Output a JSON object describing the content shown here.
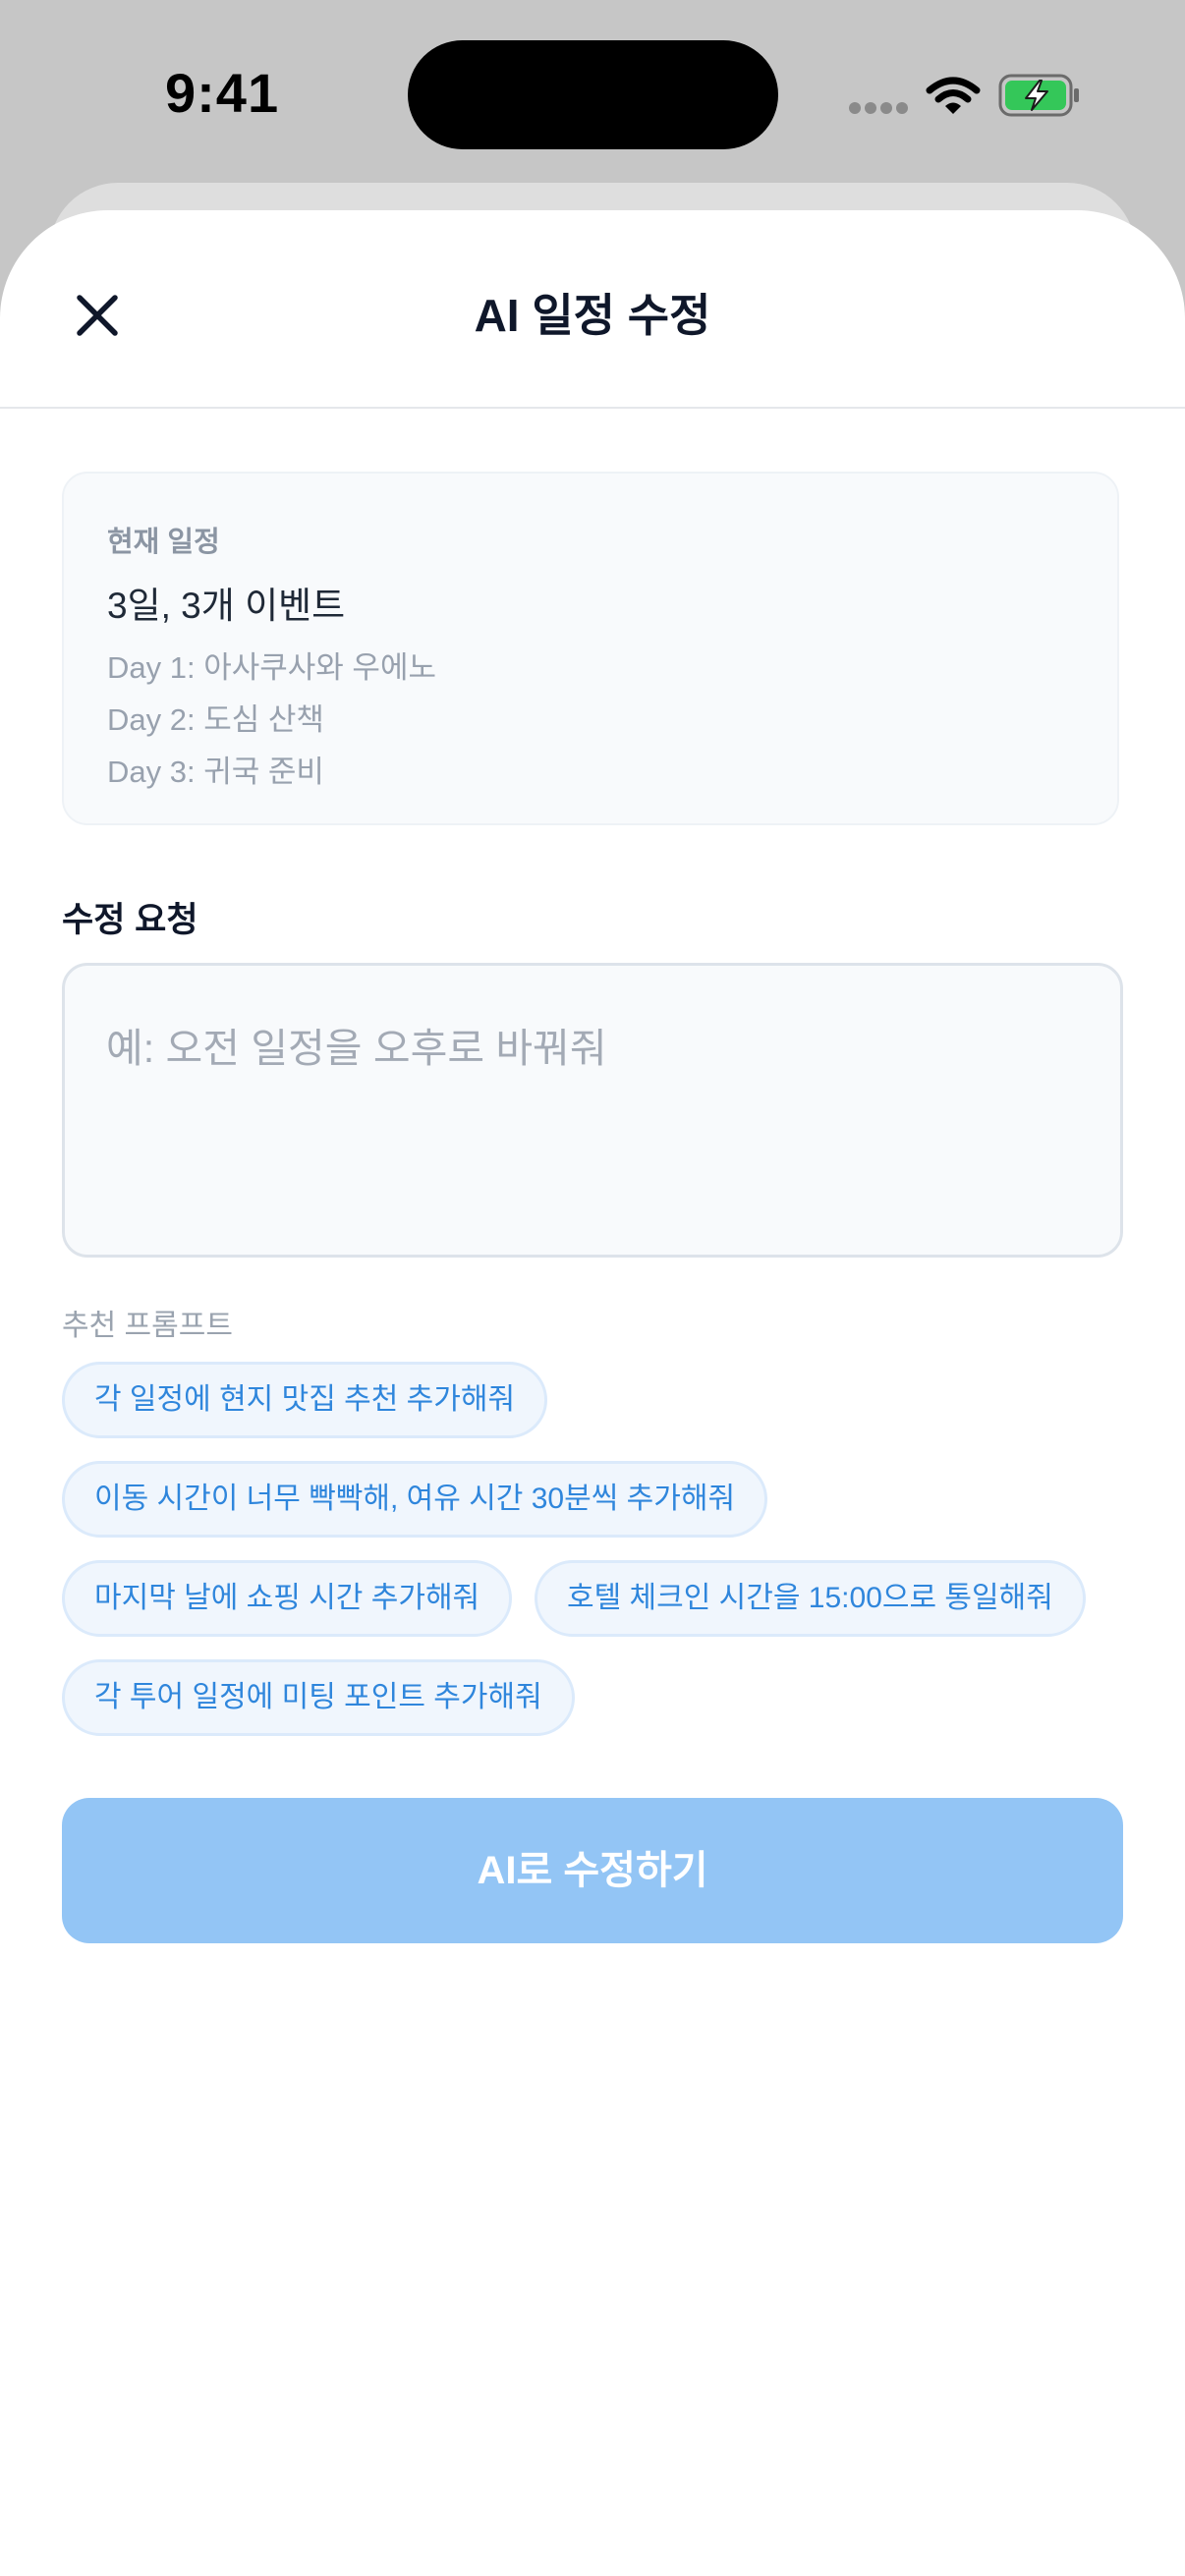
{
  "status_bar": {
    "time": "9:41",
    "icons": [
      "cellular-signal-icon",
      "wifi-icon",
      "battery-charging-icon"
    ],
    "battery_color": "#34c759"
  },
  "sheet": {
    "title": "AI 일정 수정",
    "close_icon": "close-icon"
  },
  "current_schedule": {
    "label": "현재 일정",
    "summary": "3일, 3개 이벤트",
    "days": [
      "Day 1: 아사쿠사와 우에노",
      "Day 2: 도심 산책",
      "Day 3: 귀국 준비"
    ]
  },
  "request": {
    "label": "수정 요청",
    "value": "",
    "placeholder": "예: 오전 일정을 오후로 바꿔줘"
  },
  "suggestions": {
    "label": "추천 프롬프트",
    "items": [
      "각 일정에 현지 맛집 추천 추가해줘",
      "이동 시간이 너무 빡빡해, 여유 시간 30분씩 추가해줘",
      "마지막 날에 쇼핑 시간 추가해줘",
      "호텔 체크인 시간을 15:00으로 통일해줘",
      "각 투어 일정에 미팅 포인트 추가해줘"
    ]
  },
  "submit": {
    "label": "AI로 수정하기",
    "enabled": false
  },
  "colors": {
    "accent": "#2f86dc",
    "button_disabled": "#93c5f5",
    "chip_bg": "#f0f6fd"
  }
}
